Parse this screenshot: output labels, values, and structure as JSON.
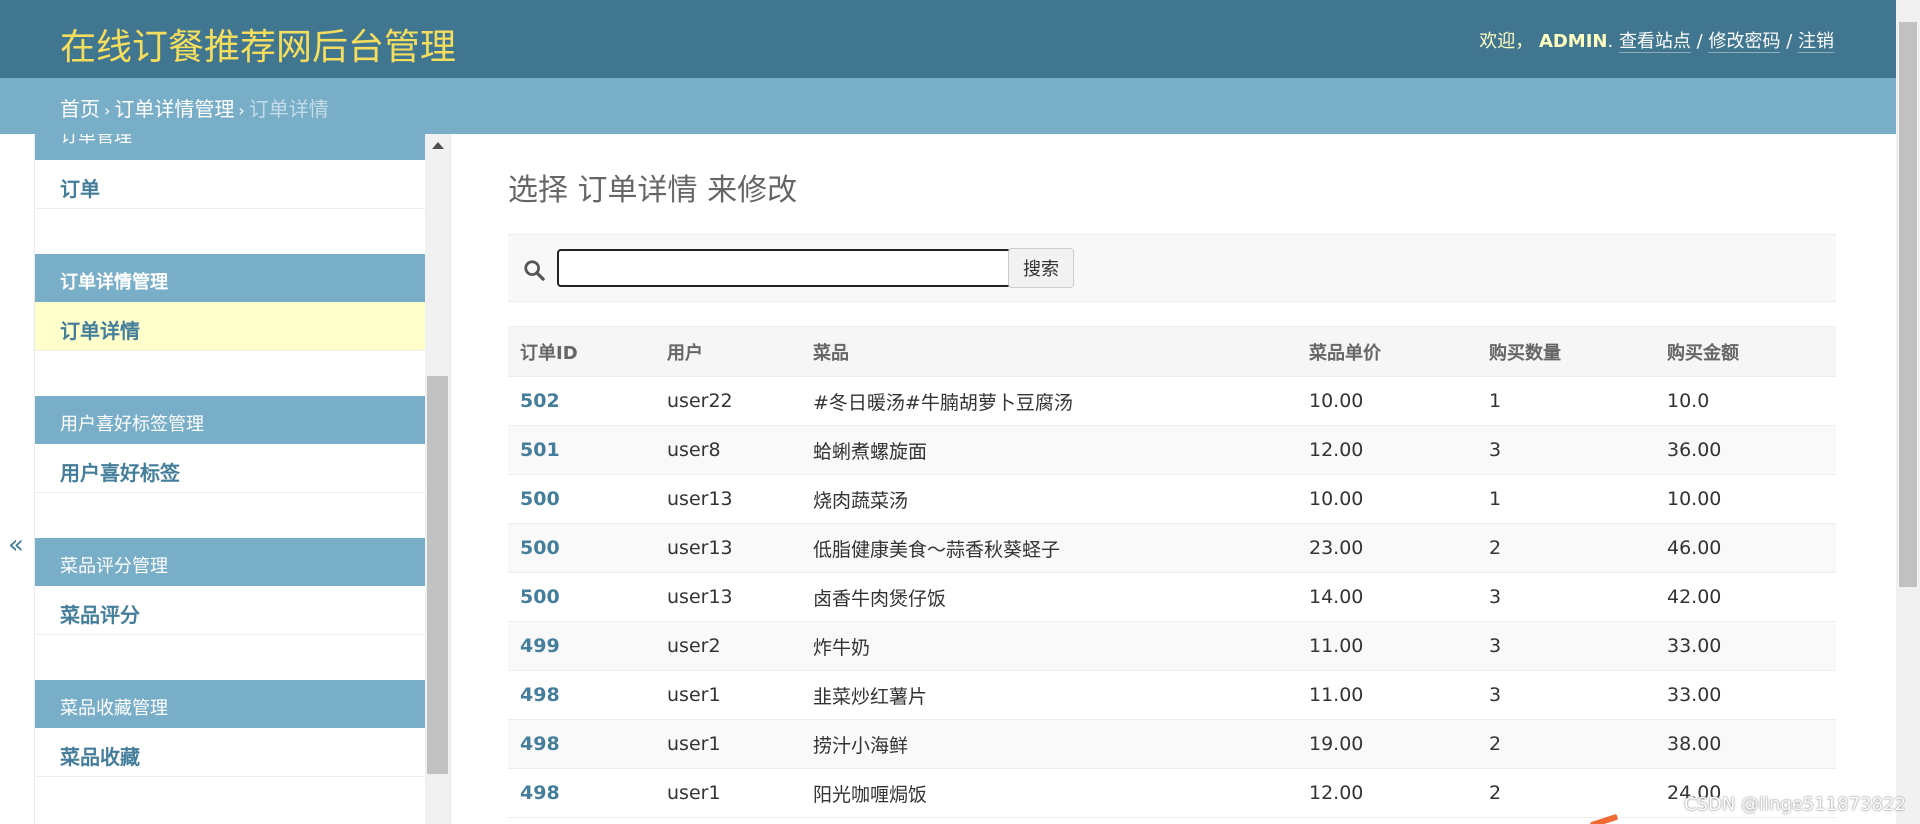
{
  "header": {
    "site_title": "在线订餐推荐网后台管理",
    "welcome": "欢迎，",
    "username": "ADMIN",
    "view_site": "查看站点",
    "change_password": "修改密码",
    "logout": "注销"
  },
  "breadcrumbs": {
    "home": "首页",
    "section": "订单详情管理",
    "current": "订单详情"
  },
  "sidebar": {
    "modules": [
      {
        "caption": "订单管理",
        "model": "订单"
      },
      {
        "caption": "订单详情管理",
        "model": "订单详情"
      },
      {
        "caption": "用户喜好标签管理",
        "model": "用户喜好标签"
      },
      {
        "caption": "菜品评分管理",
        "model": "菜品评分"
      },
      {
        "caption": "菜品收藏管理",
        "model": "菜品收藏"
      }
    ],
    "toggle_icon": "«"
  },
  "content": {
    "title": "选择 订单详情 来修改",
    "search_placeholder": "",
    "search_button": "搜索"
  },
  "table": {
    "columns": [
      "订单ID",
      "用户",
      "菜品",
      "菜品单价",
      "购买数量",
      "购买金额"
    ],
    "rows": [
      [
        "502",
        "user22",
        "#冬日暖汤#牛腩胡萝卜豆腐汤",
        "10.00",
        "1",
        "10.0"
      ],
      [
        "501",
        "user8",
        "蛤蜊煮螺旋面",
        "12.00",
        "3",
        "36.00"
      ],
      [
        "500",
        "user13",
        "烧肉蔬菜汤",
        "10.00",
        "1",
        "10.00"
      ],
      [
        "500",
        "user13",
        "低脂健康美食～蒜香秋葵蛏子",
        "23.00",
        "2",
        "46.00"
      ],
      [
        "500",
        "user13",
        "卤香牛肉煲仔饭",
        "14.00",
        "3",
        "42.00"
      ],
      [
        "499",
        "user2",
        "炸牛奶",
        "11.00",
        "3",
        "33.00"
      ],
      [
        "498",
        "user1",
        "韭菜炒红薯片",
        "11.00",
        "3",
        "33.00"
      ],
      [
        "498",
        "user1",
        "捞汁小海鲜",
        "19.00",
        "2",
        "38.00"
      ],
      [
        "498",
        "user1",
        "阳光咖喱焗饭",
        "12.00",
        "2",
        "24.00"
      ]
    ]
  },
  "watermark": "CSDN @linge511873822",
  "colors": {
    "header_bg": "#417690",
    "breadcrumb_bg": "#79aec8",
    "title_yellow": "#f5dd5d",
    "link_blue": "#447e9b",
    "selected_row": "#ffffcc"
  }
}
